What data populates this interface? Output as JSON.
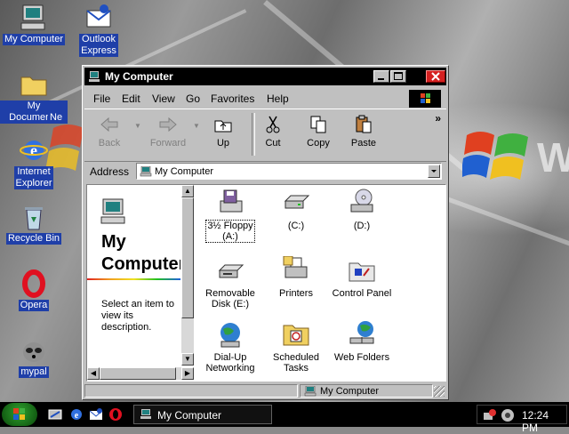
{
  "desktop": {
    "icons": [
      {
        "label": "My Computer",
        "icon": "my-computer-icon"
      },
      {
        "label": "Outlook\nExpress",
        "icon": "outlook-express-icon"
      },
      {
        "label": "My Documents",
        "icon": "folder-icon"
      },
      {
        "label": "Ne",
        "icon": "network-icon"
      },
      {
        "label": "Internet\nExplorer",
        "icon": "internet-explorer-icon"
      },
      {
        "label": "Recycle Bin",
        "icon": "recycle-bin-icon"
      },
      {
        "label": "Opera",
        "icon": "opera-icon"
      },
      {
        "label": "mypal",
        "icon": "mypal-icon"
      }
    ]
  },
  "window": {
    "title": "My Computer",
    "menu": [
      "File",
      "Edit",
      "View",
      "Go",
      "Favorites",
      "Help"
    ],
    "toolbar": {
      "back": "Back",
      "forward": "Forward",
      "up": "Up",
      "cut": "Cut",
      "copy": "Copy",
      "paste": "Paste",
      "more": "»"
    },
    "address": {
      "label": "Address",
      "value": "My Computer"
    },
    "left_panel": {
      "title_line1": "My",
      "title_line2": "Computer",
      "description": "Select an item to view its description."
    },
    "items": [
      {
        "label": "3½ Floppy\n(A:)",
        "icon": "floppy-drive-icon"
      },
      {
        "label": "(C:)",
        "icon": "hard-drive-icon"
      },
      {
        "label": "(D:)",
        "icon": "cd-drive-icon"
      },
      {
        "label": "Removable\nDisk (E:)",
        "icon": "removable-disk-icon"
      },
      {
        "label": "Printers",
        "icon": "printers-icon"
      },
      {
        "label": "Control Panel",
        "icon": "control-panel-icon"
      },
      {
        "label": "Dial-Up\nNetworking",
        "icon": "dial-up-networking-icon"
      },
      {
        "label": "Scheduled\nTasks",
        "icon": "scheduled-tasks-icon"
      },
      {
        "label": "Web Folders",
        "icon": "web-folders-icon"
      }
    ],
    "status": "My Computer"
  },
  "taskbar": {
    "task_label": "My Computer",
    "clock": "12:24 PM"
  },
  "colors": {
    "selection_blue": "#1f3fa8",
    "title_bar": "#000000",
    "close_red": "#d42020"
  }
}
